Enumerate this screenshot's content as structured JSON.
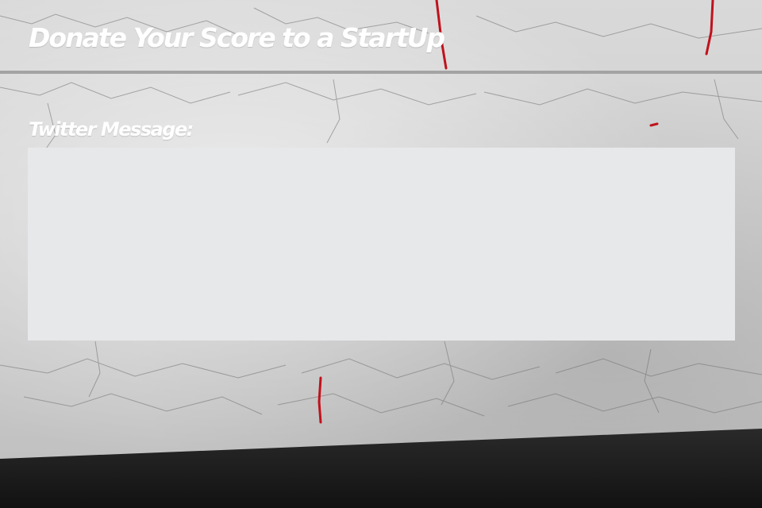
{
  "header": {
    "title": "Donate Your Score to a StartUp"
  },
  "form": {
    "twitter_message_label": "Twitter Message:",
    "twitter_message_value": "",
    "twitter_message_placeholder": ""
  },
  "colors": {
    "title_text": "#ffffff",
    "divider": "#a3a3a3",
    "textbox_bg": "#e7e8ea",
    "paint_accent": "#c0121c",
    "floor": "#141414"
  },
  "background": {
    "description_icon": "cracked-white-paint-wall-texture"
  }
}
